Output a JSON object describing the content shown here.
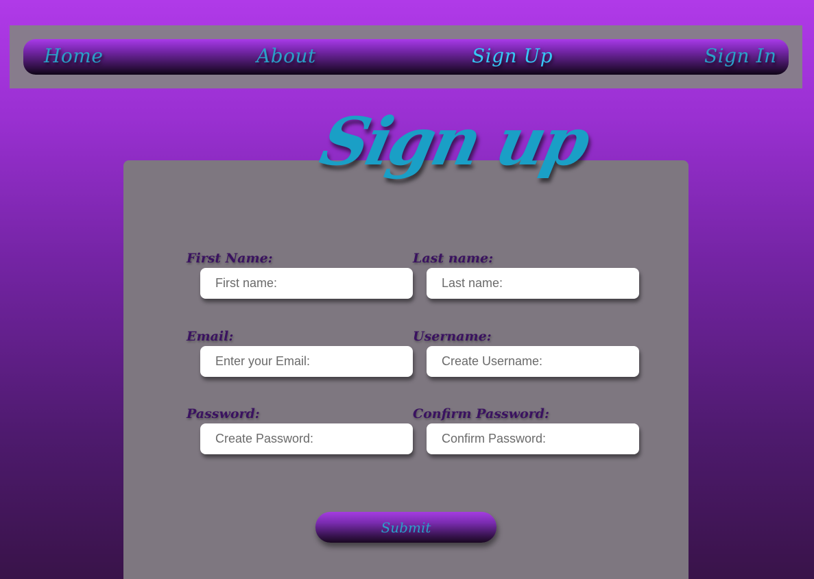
{
  "nav": {
    "home": "Home",
    "about": "About",
    "signup": "Sign Up",
    "signin": "Sign In",
    "active": "signup"
  },
  "page": {
    "title": "Sign up"
  },
  "form": {
    "first_name": {
      "label": "First Name:",
      "placeholder": "First name:"
    },
    "last_name": {
      "label": "Last name:",
      "placeholder": "Last name:"
    },
    "email": {
      "label": "Email:",
      "placeholder": "Enter your Email:"
    },
    "username": {
      "label": "Username:",
      "placeholder": "Create Username:"
    },
    "password": {
      "label": "Password:",
      "placeholder": "Create Password:"
    },
    "confirm_password": {
      "label": "Confirm Password:",
      "placeholder": "Confirm Password:"
    },
    "submit_label": "Submit"
  },
  "colors": {
    "accent": "#1a9fc6",
    "label": "#3a1260",
    "card": "#7e7780",
    "nav_panel": "#877c8c"
  }
}
